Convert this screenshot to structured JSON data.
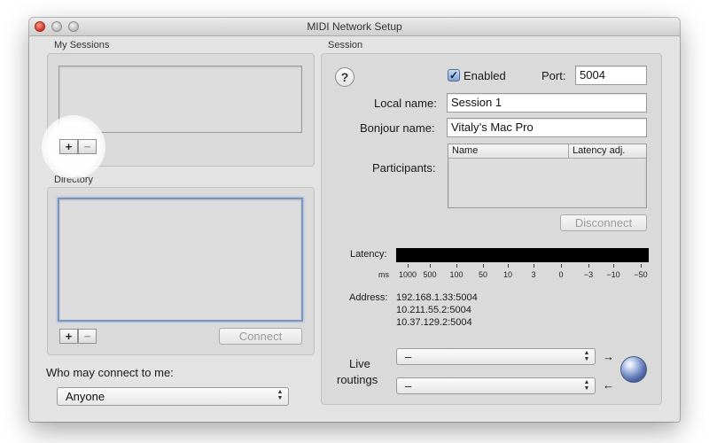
{
  "window": {
    "title": "MIDI Network Setup"
  },
  "my_sessions": {
    "label": "My Sessions",
    "add_label": "+",
    "remove_label": "−"
  },
  "directory": {
    "label": "Directory",
    "add_label": "+",
    "remove_label": "−",
    "connect_label": "Connect"
  },
  "who_may_connect": {
    "label": "Who may connect to me:",
    "value": "Anyone"
  },
  "session": {
    "label": "Session",
    "help_label": "?",
    "enabled_label": "Enabled",
    "enabled_check": "✓",
    "enabled": true,
    "port_label": "Port:",
    "port_value": "5004",
    "local_name_label": "Local name:",
    "local_name_value": "Session 1",
    "bonjour_name_label": "Bonjour name:",
    "bonjour_name_value": "Vitaly’s Mac Pro",
    "participants_label": "Participants:",
    "participants_columns": [
      "Name",
      "Latency adj."
    ],
    "disconnect_label": "Disconnect",
    "latency_label": "Latency:",
    "latency_unit": "ms",
    "latency_ticks": [
      "1000",
      "500",
      "100",
      "50",
      "10",
      "3",
      "0",
      "−3",
      "−10",
      "−50"
    ],
    "address_label": "Address:",
    "addresses": [
      "192.168.1.33:5004",
      "10.211.55.2:5004",
      "10.37.129.2:5004"
    ],
    "live_routings_label_1": "Live",
    "live_routings_label_2": "routings",
    "routing_in_value": "–",
    "routing_out_value": "–",
    "arrow_out": "→",
    "arrow_in": "←"
  },
  "icons": {
    "popup_arrows_up": "▲",
    "popup_arrows_down": "▼"
  }
}
